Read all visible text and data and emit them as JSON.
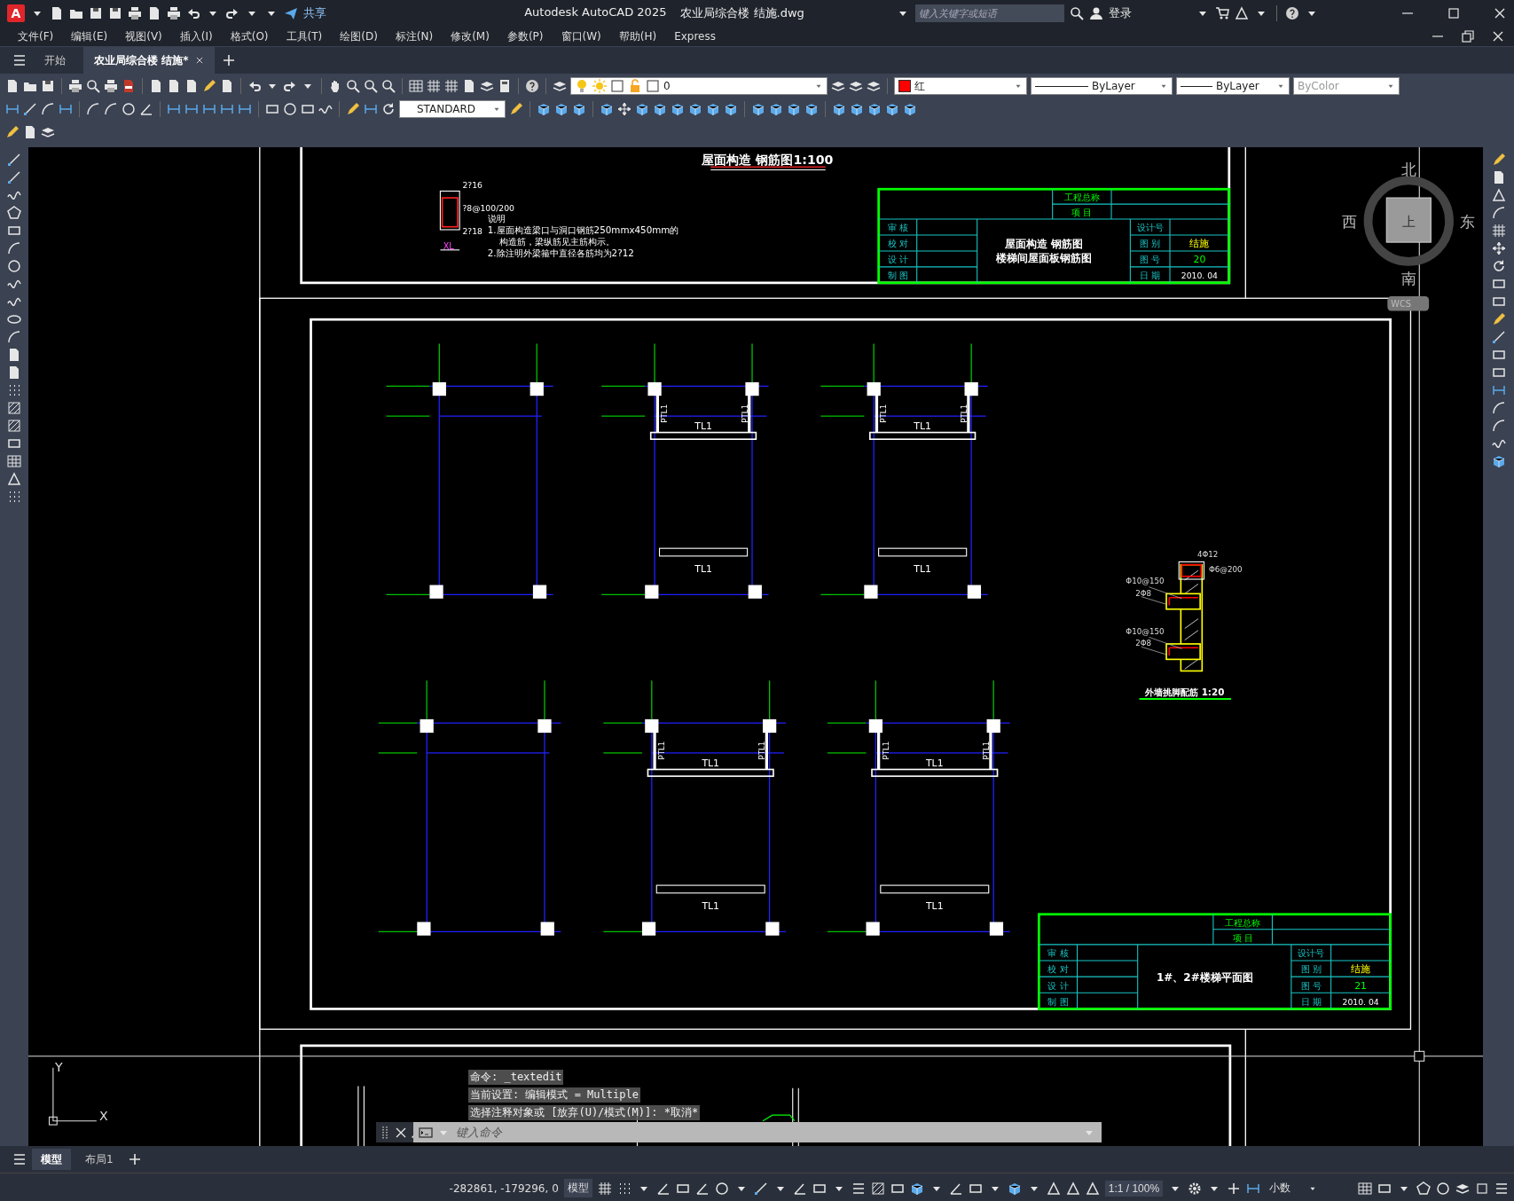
{
  "window": {
    "logo": "A",
    "app_title": "Autodesk AutoCAD 2025",
    "file_title": "农业局综合楼  结施.dwg"
  },
  "quick_access": {
    "share": "共享"
  },
  "search": {
    "placeholder": "键入关键字或短语"
  },
  "account": {
    "sign_in": "登录"
  },
  "menus": [
    "文件(F)",
    "编辑(E)",
    "视图(V)",
    "插入(I)",
    "格式(O)",
    "工具(T)",
    "绘图(D)",
    "标注(N)",
    "修改(M)",
    "参数(P)",
    "窗口(W)",
    "帮助(H)",
    "Express"
  ],
  "doc_tabs": [
    {
      "label": "开始",
      "selected": false
    },
    {
      "label": "农业局综合楼  结施*",
      "selected": true
    }
  ],
  "properties": {
    "layer": "0",
    "color": {
      "label": "红",
      "color": "#ff0000"
    },
    "linetype": "ByLayer",
    "lineweight": "ByLayer",
    "plot_style": {
      "label": "ByColor",
      "disabled": true
    }
  },
  "text_style": "STANDARD",
  "viewcube": {
    "north": "北",
    "south": "南",
    "west": "西",
    "east": "东",
    "face": "上",
    "ucs": "WCS"
  },
  "ucs_icon": {
    "x": "X",
    "y": "Y"
  },
  "roof_sheet": {
    "title": "屋面构造 钢筋图1:100",
    "section_labels": [
      "2?16",
      "?8@100/200",
      "2?18"
    ],
    "section_name": "XL",
    "notes": [
      "说明",
      "1.屋面构造梁口与洞口钢筋250mmx450mm的",
      "构造筋，梁纵筋见主筋构示。",
      "2.除注明外梁箍中直径各筋均为2?12"
    ],
    "title_block": {
      "project_label": "工程总称",
      "item_label": "项 目",
      "left_labels": [
        "审 核",
        "校 对",
        "设 计",
        "制 图"
      ],
      "drawing_name": [
        "屋面构造 钢筋图",
        "楼梯间屋面板钢筋图"
      ],
      "info": [
        {
          "label": "设计号"
        },
        {
          "label": "图 别",
          "value": "结施"
        },
        {
          "label": "图 号",
          "value": "20"
        },
        {
          "label": "日 期",
          "value": "2010. 04"
        }
      ]
    }
  },
  "stair_sheet": {
    "plans": [
      {
        "kind": "frame"
      },
      {
        "kind": "stair",
        "upper_beam": "TL1",
        "lower_beam": "TL1",
        "left_post": "PTL1",
        "right_post": "PTL1"
      },
      {
        "kind": "stair",
        "upper_beam": "TL1",
        "lower_beam": "TL1",
        "left_post": "PTL1",
        "right_post": "PTL1"
      },
      {
        "kind": "frame"
      },
      {
        "kind": "stair",
        "upper_beam": "TL1",
        "lower_beam": "TL1",
        "left_post": "PTL1",
        "right_post": "PTL1"
      },
      {
        "kind": "stair",
        "upper_beam": "TL1",
        "lower_beam": "TL1",
        "left_post": "PTL1",
        "right_post": "PTL1"
      }
    ],
    "detail": {
      "labels": [
        "4Φ12",
        "Φ6@200",
        "Φ10@150",
        "2Φ8",
        "Φ10@150",
        "2Φ8"
      ],
      "title": "外墙挑脚配筋 1:20"
    },
    "title_block": {
      "project_label": "工程总称",
      "item_label": "项 目",
      "left_labels": [
        "审 核",
        "校 对",
        "设 计",
        "制 图"
      ],
      "drawing_name": [
        "1#、2#楼梯平面图"
      ],
      "info": [
        {
          "label": "设计号"
        },
        {
          "label": "图 别",
          "value": "结施"
        },
        {
          "label": "图 号",
          "value": "21"
        },
        {
          "label": "日 期",
          "value": "2010. 04"
        }
      ]
    }
  },
  "command_line": {
    "history": [
      "命令: _textedit",
      "当前设置: 编辑模式 = Multiple",
      "选择注释对象或 [放弃(U)/模式(M)]: *取消*"
    ],
    "placeholder": "键入命令"
  },
  "layout_tabs": [
    {
      "label": "模型",
      "selected": true
    },
    {
      "label": "布局1",
      "selected": false
    }
  ],
  "status_bar": {
    "coordinates": "-282861, -179296, 0",
    "space": "模型",
    "scale": "1:1 / 100%",
    "units": "小数"
  }
}
